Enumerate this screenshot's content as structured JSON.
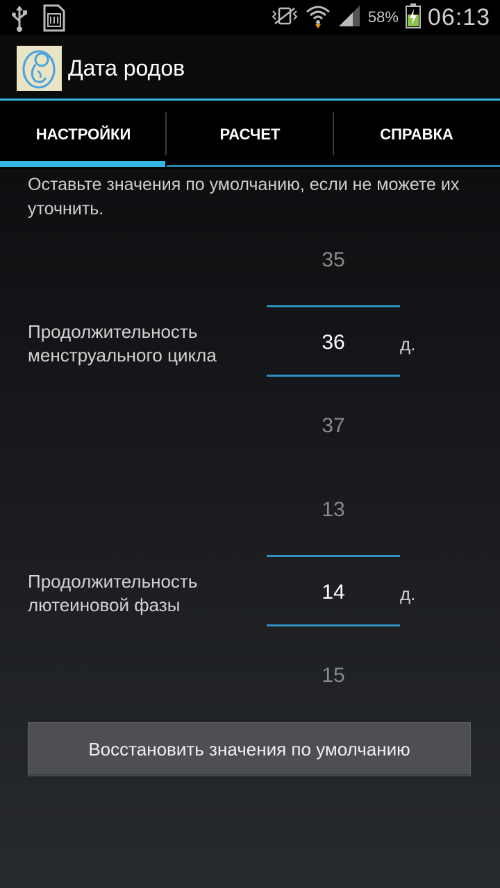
{
  "status_bar": {
    "left_icons": [
      "usb-icon",
      "sd-card-icon"
    ],
    "right_icons": [
      "vibrate-icon",
      "wifi-icon",
      "signal-icon",
      "battery-charging-icon"
    ],
    "battery_percent": "58%",
    "time": "06:13",
    "accent": "#33b5e5"
  },
  "app": {
    "title": "Дата родов",
    "icon": "fetus-icon"
  },
  "tabs": [
    {
      "label": "НАСТРОЙКИ",
      "selected": true
    },
    {
      "label": "РАСЧЕТ",
      "selected": false
    },
    {
      "label": "СПРАВКА",
      "selected": false
    }
  ],
  "settings": {
    "hint": "Оставьте значения по умолчанию, если не можете их уточнить.",
    "cycle": {
      "label_line1": "Продолжительность",
      "label_line2": "менструального цикла",
      "prev": "35",
      "value": "36",
      "next": "37",
      "unit": "д."
    },
    "luteal": {
      "label_line1": "Продолжительность",
      "label_line2": "лютеиновой фазы",
      "prev": "13",
      "value": "14",
      "next": "15",
      "unit": "д."
    },
    "reset_label": "Восстановить значения по умолчанию"
  }
}
